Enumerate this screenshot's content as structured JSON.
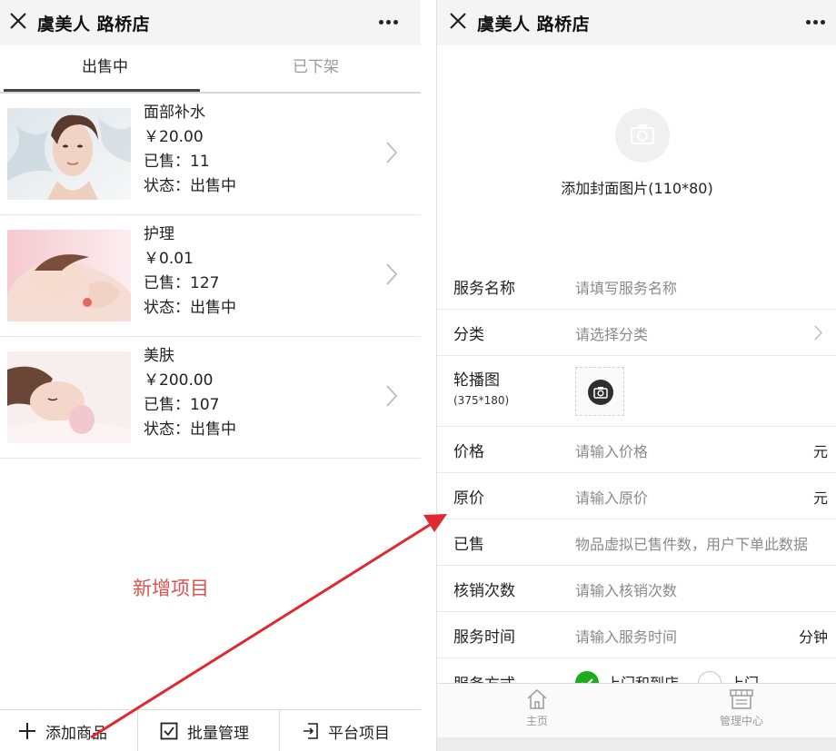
{
  "left": {
    "store_title": "虞美人 路桥店",
    "tabs": [
      {
        "label": "出售中",
        "active": true
      },
      {
        "label": "已下架",
        "active": false
      }
    ],
    "products": [
      {
        "name": "面部补水",
        "price": "￥20.00",
        "sold": "已售：11",
        "status": "状态：出售中"
      },
      {
        "name": "护理",
        "price": "￥0.01",
        "sold": "已售：127",
        "status": "状态：出售中"
      },
      {
        "name": "美肤",
        "price": "￥200.00",
        "sold": "已售：107",
        "status": "状态：出售中"
      }
    ],
    "annotation": "新增项目",
    "bottom_bar": {
      "add_label": "添加商品",
      "batch_label": "批量管理",
      "platform_label": "平台项目"
    }
  },
  "right": {
    "store_title": "虞美人 路桥店",
    "cover_label": "添加封面图片(110*80)",
    "form": {
      "service_name": {
        "label": "服务名称",
        "placeholder": "请填写服务名称"
      },
      "category": {
        "label": "分类",
        "placeholder": "请选择分类"
      },
      "carousel": {
        "label": "轮播图",
        "size": "(375*180)"
      },
      "price": {
        "label": "价格",
        "placeholder": "请输入价格",
        "unit": "元"
      },
      "original_price": {
        "label": "原价",
        "placeholder": "请输入原价",
        "unit": "元"
      },
      "sold": {
        "label": "已售",
        "placeholder": "物品虚拟已售件数，用户下单此数据"
      },
      "verify_count": {
        "label": "核销次数",
        "placeholder": "请输入核销次数"
      },
      "service_time": {
        "label": "服务时间",
        "placeholder": "请输入服务时间",
        "unit": "分钟"
      },
      "service_mode": {
        "label": "服务方式",
        "option_1": "上门和到店",
        "option_2": "上门"
      }
    },
    "tabbar": {
      "home_label": "主页",
      "manage_label": "管理中心"
    }
  },
  "colors": {
    "annotation": "#d9534f",
    "arrow": "#e0282f",
    "radio_selected": "#1aad19"
  }
}
